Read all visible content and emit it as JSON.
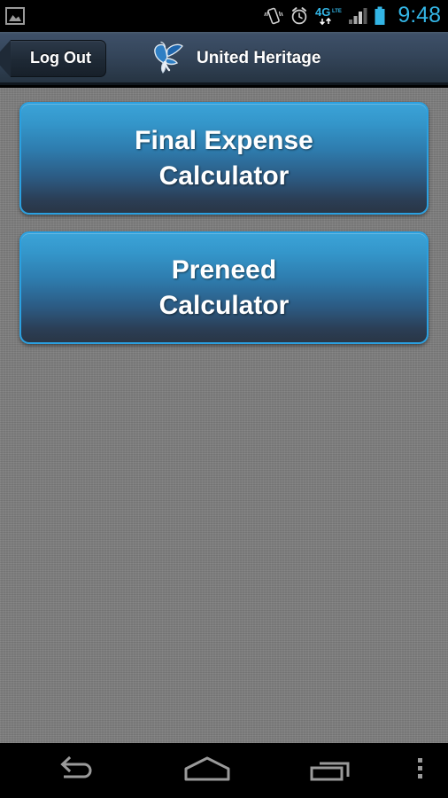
{
  "status_bar": {
    "time": "9:48",
    "time_color": "#33b5e5",
    "left_icons": [
      {
        "name": "gallery-image-icon",
        "label": "Image"
      }
    ],
    "right_icons": [
      {
        "name": "vibrate-icon",
        "label": "Vibrate"
      },
      {
        "name": "alarm-clock-icon",
        "label": "Alarm"
      },
      {
        "name": "network-4g-lte-icon",
        "label": "4G LTE"
      },
      {
        "name": "signal-bars-icon",
        "label": "Signal"
      },
      {
        "name": "battery-icon",
        "label": "Battery"
      }
    ]
  },
  "action_bar": {
    "logout_label": "Log Out",
    "app_title": "United Heritage",
    "logo_name": "butterfly-logo",
    "background_top": "#3e5068",
    "background_bottom": "#263442"
  },
  "main": {
    "buttons": [
      {
        "name": "final-expense-calculator-button",
        "label": "Final Expense\nCalculator",
        "line1": "Final Expense",
        "line2": "Calculator"
      },
      {
        "name": "preneed-calculator-button",
        "label": "Preneed\nCalculator",
        "line1": "Preneed",
        "line2": "Calculator"
      }
    ],
    "background_color": "#7e7e7e",
    "button_border_color": "#2ba0e0",
    "button_gradient_top": "#3ba3d8",
    "button_gradient_bottom": "#2a3646"
  },
  "nav_bar": {
    "buttons": [
      {
        "name": "nav-back-button",
        "label": "Back"
      },
      {
        "name": "nav-home-button",
        "label": "Home"
      },
      {
        "name": "nav-recents-button",
        "label": "Recent apps"
      },
      {
        "name": "nav-overflow-menu-button",
        "label": "Menu"
      }
    ]
  }
}
